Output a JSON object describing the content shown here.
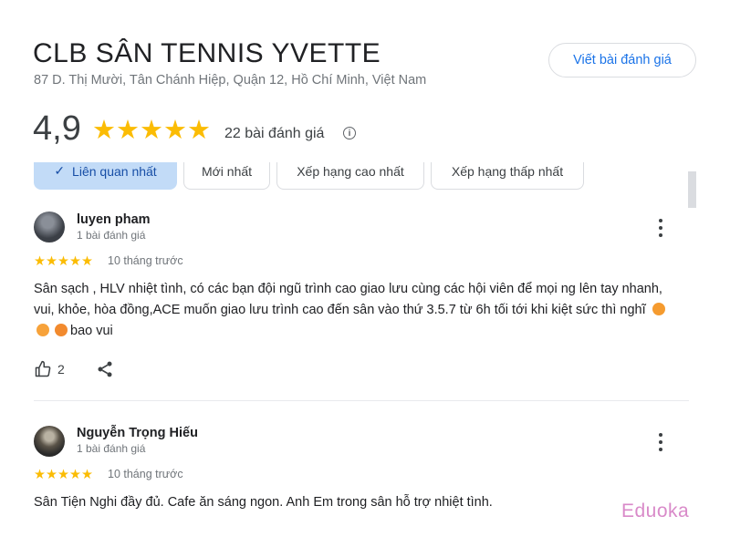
{
  "place": {
    "title": "CLB SÂN TENNIS YVETTE",
    "address": "87 D. Thị Mười, Tân Chánh Hiệp, Quận 12, Hồ Chí Minh, Việt Nam",
    "write_review_label": "Viết bài đánh giá",
    "rating": "4,9",
    "stars_glyphs": "★★★★★",
    "review_count": "22 bài đánh giá",
    "info_glyph": "i"
  },
  "sort_chips": [
    {
      "label": "Liên quan nhất",
      "selected": true,
      "check": "✓"
    },
    {
      "label": "Mới nhất",
      "selected": false
    },
    {
      "label": "Xếp hạng cao nhất",
      "selected": false
    },
    {
      "label": "Xếp hạng thấp nhất",
      "selected": false
    }
  ],
  "reviews": [
    {
      "author": "luyen pham",
      "author_meta": "1 bài đánh giá",
      "stars": "★★★★★",
      "rating": 5,
      "time": "10 tháng trước",
      "text": "Sân sạch , HLV nhiệt tình, có các bạn đội ngũ trình cao giao lưu cùng các hội viên để mọi ng lên tay nhanh, vui, khỏe, hòa đồng,ACE muốn giao lưu trình cao đến sân vào thứ 3.5.7 từ 6h tối tới khi kiệt sức thì nghĩ",
      "text_tail": "bao vui",
      "likes": "2"
    },
    {
      "author": "Nguyễn Trọng Hiếu",
      "author_meta": "1 bài đánh giá",
      "stars": "★★★★★",
      "rating": 5,
      "time": "10 tháng trước",
      "text": "Sân Tiện Nghi đầy đủ. Cafe ăn sáng ngon. Anh Em trong sân hỗ trợ nhiệt tình."
    }
  ],
  "watermark": "Eduoka",
  "colors": {
    "accent": "#1a73e8",
    "star": "#fbbc04",
    "chip_selected_bg": "#c2dbf7",
    "text_secondary": "#70757a"
  },
  "icons": [
    "info-icon",
    "check-icon",
    "kebab-menu-icon",
    "thumbs-up-icon",
    "share-icon"
  ]
}
